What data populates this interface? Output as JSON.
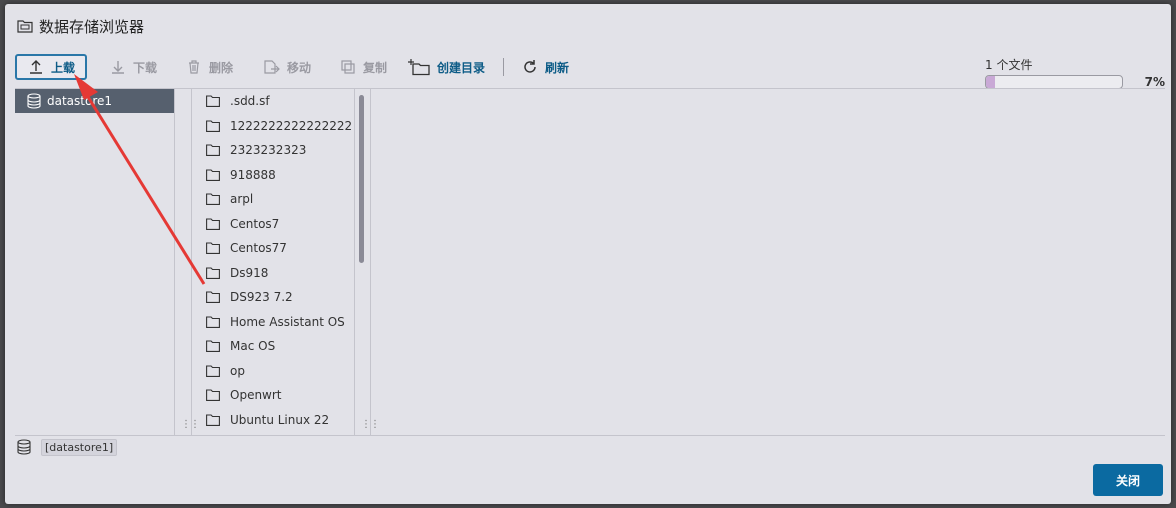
{
  "dialog": {
    "title": "数据存储浏览器",
    "title_icon": "folder-storage-icon"
  },
  "toolbar": {
    "upload": "上载",
    "download": "下载",
    "delete": "删除",
    "move": "移动",
    "copy": "复制",
    "create_dir": "创建目录",
    "refresh": "刷新"
  },
  "progress": {
    "label": "1 个文件",
    "percent_text": "7%",
    "fraction": 0.07,
    "fill_color": "#c9a9d6"
  },
  "datastores": [
    {
      "label": "datastore1"
    }
  ],
  "folders": [
    {
      "name": ".sdd.sf"
    },
    {
      "name": "1222222222222222"
    },
    {
      "name": "2323232323"
    },
    {
      "name": "918888"
    },
    {
      "name": "arpl"
    },
    {
      "name": "Centos7"
    },
    {
      "name": "Centos77"
    },
    {
      "name": "Ds918"
    },
    {
      "name": "DS923 7.2"
    },
    {
      "name": "Home Assistant OS"
    },
    {
      "name": "Mac OS"
    },
    {
      "name": "op"
    },
    {
      "name": "Openwrt"
    },
    {
      "name": "Ubuntu Linux 22"
    }
  ],
  "path_bar": {
    "path": "[datastore1]"
  },
  "footer": {
    "close": "关闭"
  },
  "colors": {
    "accent": "#0b6aa1",
    "selected_row": "#56606e",
    "annotation_arrow": "#e53935"
  }
}
